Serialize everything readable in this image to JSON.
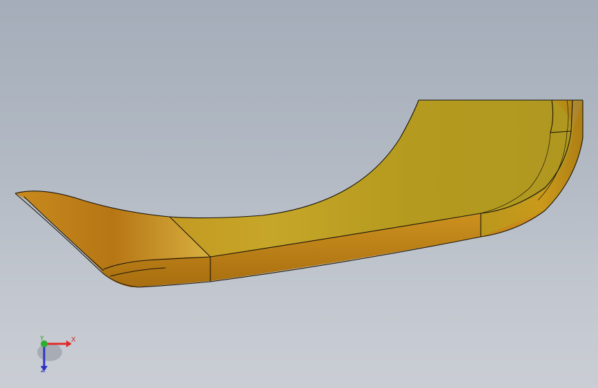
{
  "viewport": {
    "background_top": "#a4adb9",
    "background_bottom": "#cacdd4"
  },
  "model": {
    "name": "yellow-curved-part",
    "colors": {
      "base": "#b89a1c",
      "highlight": "#d6b43a",
      "shadow": "#9c6c0e",
      "edge": "#1a1408"
    }
  },
  "triad": {
    "x_label": "X",
    "y_label": "Y",
    "z_label": "Z",
    "x_color": "#e02a2a",
    "y_color": "#2fae2f",
    "z_color": "#2d33c8"
  }
}
